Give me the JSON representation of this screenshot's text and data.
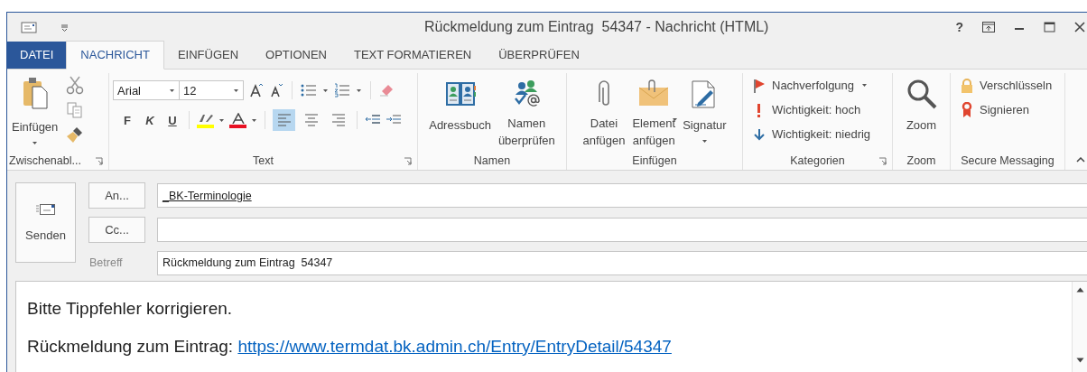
{
  "window": {
    "title": "Rückmeldung zum Eintrag  54347 - Nachricht (HTML)",
    "help": "?"
  },
  "tabs": [
    {
      "label": "DATEI",
      "kind": "file",
      "selected": false
    },
    {
      "label": "NACHRICHT",
      "kind": "tab",
      "selected": true
    },
    {
      "label": "EINFÜGEN",
      "kind": "tab",
      "selected": false
    },
    {
      "label": "OPTIONEN",
      "kind": "tab",
      "selected": false
    },
    {
      "label": "TEXT FORMATIEREN",
      "kind": "tab",
      "selected": false
    },
    {
      "label": "ÜBERPRÜFEN",
      "kind": "tab",
      "selected": false
    }
  ],
  "ribbon": {
    "groups": [
      {
        "kind": "clipboard",
        "label": "Zwischenabl...",
        "launcher": true,
        "paste": {
          "label": "Einfügen",
          "dropdown": true
        }
      },
      {
        "kind": "text",
        "label": "Text",
        "launcher": true,
        "font": "Arial",
        "size": "12",
        "format_buttons": [
          "F",
          "K",
          "U"
        ],
        "highlight": {
          "color": "#ffff00"
        },
        "font_color": {
          "color": "#e81123"
        },
        "alignment": [
          {
            "selected": true
          },
          {
            "selected": false
          },
          {
            "selected": false
          }
        ]
      },
      {
        "kind": "large",
        "label": "Namen",
        "launcher": false,
        "buttons": [
          {
            "label": "Adressbuch",
            "dropdown": false
          },
          {
            "label": "Namen\nüberprüfen",
            "dropdown": false
          }
        ]
      },
      {
        "kind": "large",
        "label": "Einfügen",
        "launcher": false,
        "buttons": [
          {
            "label": "Datei\nanfügen",
            "dropdown": false
          },
          {
            "label": "Element\nanfügen",
            "dropdown": true
          },
          {
            "label": "Signatur",
            "dropdown": true
          }
        ]
      },
      {
        "kind": "small",
        "label": "Kategorien",
        "launcher": true,
        "buttons": [
          {
            "label": "Nachverfolgung",
            "dropdown": true
          },
          {
            "label": "Wichtigkeit: hoch",
            "dropdown": false
          },
          {
            "label": "Wichtigkeit: niedrig",
            "dropdown": false
          }
        ]
      },
      {
        "kind": "large",
        "label": "Zoom",
        "launcher": false,
        "buttons": [
          {
            "label": "Zoom",
            "dropdown": false
          }
        ]
      },
      {
        "kind": "small",
        "label": "Secure Messaging",
        "launcher": false,
        "buttons": [
          {
            "label": "Verschlüsseln",
            "dropdown": false
          },
          {
            "label": "Signieren",
            "dropdown": false
          }
        ]
      }
    ]
  },
  "compose": {
    "send": "Senden",
    "to_button": "An...",
    "to": "_BK-Terminologie",
    "cc_button": "Cc...",
    "subject_label": "Betreff",
    "subject": "Rückmeldung zum Eintrag  54347"
  },
  "body": {
    "line_1": "Bitte Tippfehler korrigieren.",
    "line_2": "Rückmeldung zum Eintrag: ",
    "link": "https://www.termdat.bk.admin.ch/Entry/EntryDetail/54347"
  }
}
